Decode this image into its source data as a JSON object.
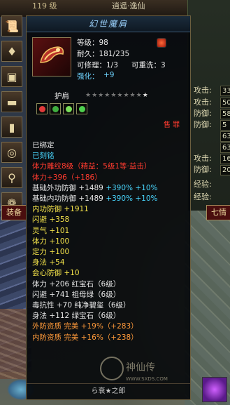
{
  "top": {
    "level_text": "119 级",
    "name_text": "逍遥·逸仙"
  },
  "left_icons": [
    "scroll-icon",
    "gem-icon",
    "armor-icon",
    "belt-icon",
    "boots-icon",
    "ring-icon",
    "ring-icon",
    "scroll-icon",
    "ring-icon"
  ],
  "left_tab": "装备",
  "right_tab": "七情",
  "stats": [
    {
      "label": "攻击:",
      "value": "33"
    },
    {
      "label": "攻击:",
      "value": "50"
    },
    {
      "label": "防御:",
      "value": "58"
    },
    {
      "label": "防御:",
      "value": "5"
    },
    {
      "label": "",
      "value": "63"
    },
    {
      "label": "",
      "value": "63"
    },
    {
      "label": "攻击:",
      "value": "16"
    },
    {
      "label": "防御:",
      "value": "20"
    }
  ],
  "stat_extra": [
    "经验:",
    "经验:"
  ],
  "tooltip": {
    "title": "幻世魔肩",
    "level": "等级：98",
    "durability": "耐久：181/235",
    "repair": "可修理：1/3",
    "rewash": "可重洗：3",
    "enhance_label": "强化：",
    "enhance_value": "+9",
    "slot_name": "护肩",
    "stars_total": 10,
    "stars_lit": 1,
    "gem_colors": [
      "#e03a3a",
      "#3fae3f",
      "#7adf5a",
      "#4ed04e"
    ],
    "cost_tag": "售  罪",
    "lines": [
      {
        "text": "已绑定",
        "color": "white"
      },
      {
        "text": "已刻铭",
        "color": "cyan"
      },
      {
        "text": "体力雕纹8级（精益：5级1等·益击）",
        "color": "red"
      },
      {
        "text": "体力+396（+186）",
        "color": "red"
      },
      {
        "text": "基础外功防御 +1489 +390% +10%",
        "color": "white",
        "tail": "+390% +10%",
        "tailcolor": "cyan"
      },
      {
        "text": "基础内功防御 +1489 +390% +10%",
        "color": "white",
        "tail": "+390% +10%",
        "tailcolor": "cyan"
      },
      {
        "text": "内功防御 +1911",
        "color": "yellow"
      },
      {
        "text": "闪避 +358",
        "color": "yellow"
      },
      {
        "text": "灵气 +101",
        "color": "yellow"
      },
      {
        "text": "体力 +100",
        "color": "yellow"
      },
      {
        "text": "定力 +100",
        "color": "yellow"
      },
      {
        "text": "身法 +54",
        "color": "yellow"
      },
      {
        "text": "会心防御 +10",
        "color": "yellow"
      },
      {
        "text": "体力 +206  红宝石（6级）",
        "color": "white"
      },
      {
        "text": "闪避 +741  祖母绿（6级）",
        "color": "white"
      },
      {
        "text": "毒抗性 +70  纯净碧玺（6级）",
        "color": "white"
      },
      {
        "text": "身法 +112  绿宝石（6级）",
        "color": "white"
      },
      {
        "text": "外防资质  完美 +19%（+283）",
        "color": "orange"
      },
      {
        "text": "内防资质  完美 +16%（+238）",
        "color": "orange"
      }
    ],
    "footer": "ら衰★之郎"
  },
  "watermark": "神仙传 WWW.SXDS.COM"
}
